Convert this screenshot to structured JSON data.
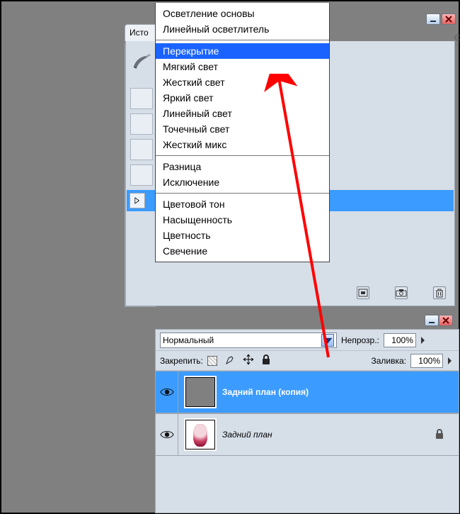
{
  "history": {
    "tab_label": "Исто"
  },
  "blend_menu": {
    "groups": [
      [
        "Осветление основы",
        "Линейный осветлитель"
      ],
      [
        "Перекрытие",
        "Мягкий свет",
        "Жесткий свет",
        "Яркий свет",
        "Линейный свет",
        "Точечный свет",
        "Жесткий микс"
      ],
      [
        "Разница",
        "Исключение"
      ],
      [
        "Цветовой тон",
        "Насыщенность",
        "Цветность",
        "Свечение"
      ]
    ],
    "selected": "Перекрытие"
  },
  "layers": {
    "mode_field_value": "Нормальный",
    "opacity_label": "Непрозр.:",
    "opacity_value": "100%",
    "lock_label": "Закрепить:",
    "fill_label": "Заливка:",
    "fill_value": "100%",
    "items": [
      {
        "name": "Задний план (копия)",
        "selected": true,
        "locked": false
      },
      {
        "name": "Задний план",
        "selected": false,
        "locked": true
      }
    ]
  }
}
